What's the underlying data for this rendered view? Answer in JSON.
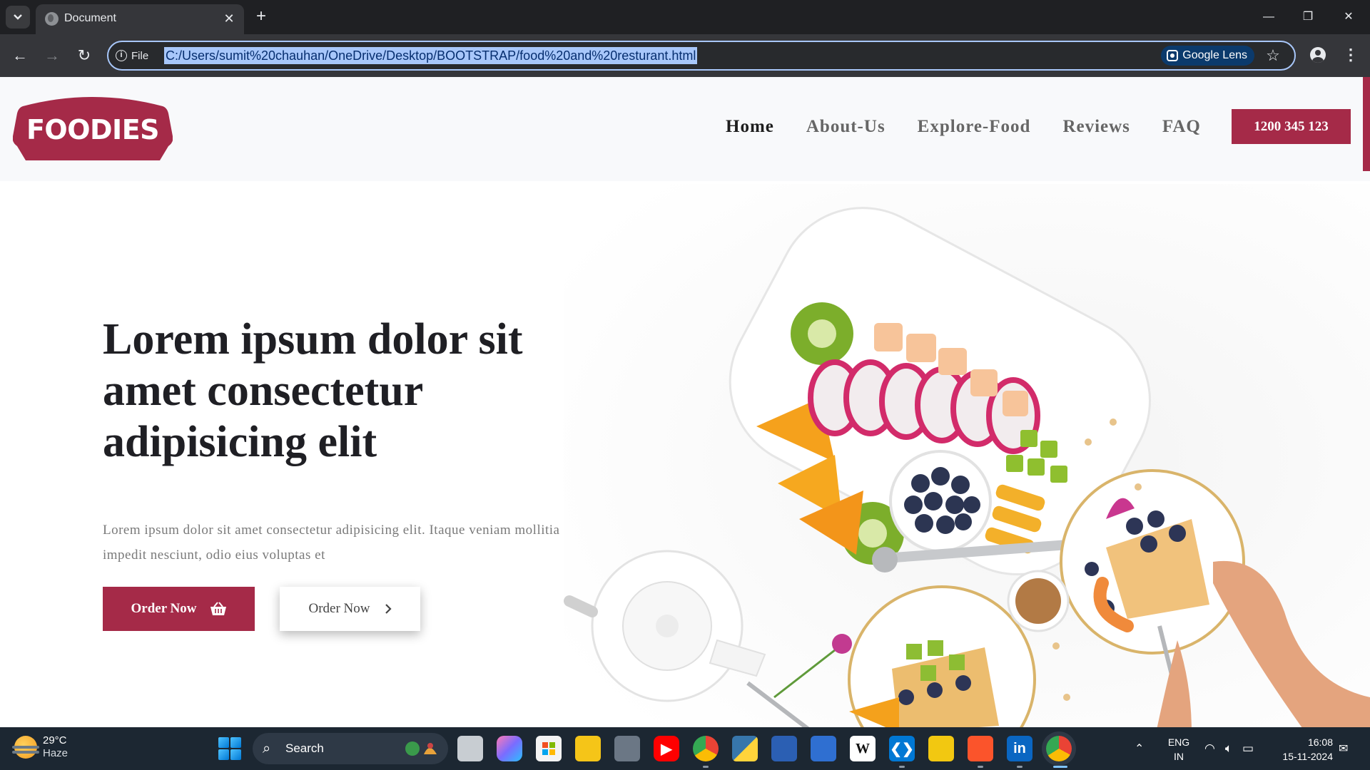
{
  "browser": {
    "tab_title": "Document",
    "site_info_label": "File",
    "url": "C:/Users/sumit%20chauhan/OneDrive/Desktop/BOOTSTRAP/food%20and%20resturant.html",
    "lens_label": "Google Lens"
  },
  "navbar": {
    "logo_text": "FOODIES",
    "links": [
      "Home",
      "About-Us",
      "Explore-Food",
      "Reviews",
      "FAQ"
    ],
    "active_link": "Home",
    "phone": "1200 345 123"
  },
  "hero": {
    "title": "Lorem ipsum dolor sit amet consectetur adipisicing elit",
    "text": "Lorem ipsum dolor sit amet consectetur adipisicing elit. Itaque veniam mollitia impedit nesciunt, odio eius voluptas et",
    "primary_button": "Order Now",
    "secondary_button": "Order Now"
  },
  "colors": {
    "brand": "#a52a48",
    "heading": "#1f1f24",
    "nav_text": "#666666"
  },
  "taskbar": {
    "weather_temp": "29°C",
    "weather_condition": "Haze",
    "search_label": "Search",
    "language": "ENG",
    "region": "IN",
    "time": "16:08",
    "date": "15-11-2024",
    "pinned_apps": [
      "task-view",
      "copilot",
      "microsoft-store",
      "file-explorer",
      "calculator",
      "youtube",
      "chrome-profile",
      "python",
      "powershell-script",
      "document-editor",
      "wikipedia",
      "vs-code",
      "power-bi",
      "brave",
      "linkedin",
      "chrome"
    ]
  }
}
